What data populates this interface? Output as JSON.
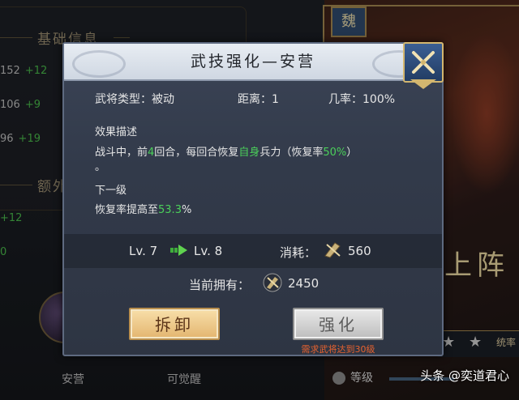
{
  "background": {
    "section1_title": "基础信息",
    "section2_title": "额外",
    "stats": [
      {
        "value": "152",
        "bonus": "+12"
      },
      {
        "value": "106",
        "bonus": "+9"
      },
      {
        "value": "96",
        "bonus": "+19"
      }
    ],
    "extra_bonus": "+12",
    "extra_value": "0",
    "tab_left": "安营",
    "tab_right": "可觉醒",
    "badge": "魏",
    "right_banner": "上阵",
    "right_bottom": "统率",
    "level_label": "等级"
  },
  "dialog": {
    "title": "武技强化—安营",
    "type_label": "武将类型：",
    "type_value": "被动",
    "range_label": "距离：",
    "range_value": "1",
    "chance_label": "几率：",
    "chance_value": "100%",
    "effect_heading": "效果描述",
    "effect_pre": "战斗中，前",
    "effect_turns": "4",
    "effect_mid": "回合，每回合恢复",
    "effect_self": "自身",
    "effect_mid2": "兵力（恢复率",
    "effect_rate": "50%",
    "effect_post": "）",
    "effect_line2": "。",
    "next_heading": "下一级",
    "next_pre": "恢复率提高至",
    "next_rate": "53.3",
    "next_post": "%",
    "level_from": "Lv. 7",
    "level_to": "Lv. 8",
    "cost_label": "消耗：",
    "cost_value": "560",
    "owned_label": "当前拥有：",
    "owned_value": "2450",
    "dismantle_label": "拆卸",
    "enhance_label": "强化",
    "requirement": "需求武将达到30级"
  },
  "watermark": {
    "prefix": "头条",
    "handle": "@奕道君心"
  },
  "colors": {
    "highlight_green": "#4bd05a",
    "requirement_orange": "#e8622f",
    "dismantle_button": "#e3b56f",
    "enhance_button_disabled": "#bdbdbd"
  }
}
